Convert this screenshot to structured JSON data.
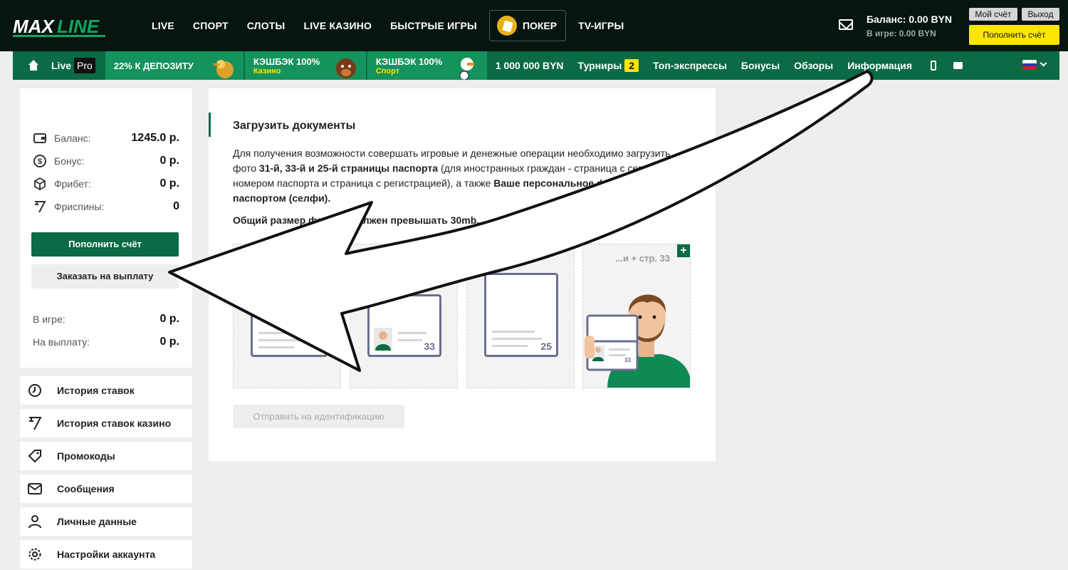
{
  "header": {
    "logo_text": "MAXLINE",
    "nav": [
      "LIVE",
      "СПОРТ",
      "СЛОТЫ",
      "LIVE КАЗИНО",
      "БЫСТРЫЕ ИГРЫ"
    ],
    "poker_label": "ПОКЕР",
    "tv_label": "TV-ИГРЫ",
    "balance_label": "Баланс: 0.00 BYN",
    "in_game_label": "В игре: 0.00 BYN",
    "my_account": "Мой счёт",
    "logout": "Выход",
    "topup": "Пополнить счёт"
  },
  "greenbar": {
    "live": "Live",
    "pro": "Pro",
    "promos": [
      {
        "title": "22% К ДЕПОЗИТУ",
        "sub": ""
      },
      {
        "title": "КЭШБЭК 100%",
        "sub": "Казино"
      },
      {
        "title": "КЭШБЭК 100%",
        "sub": "Спорт"
      }
    ],
    "items": [
      "1 000 000 BYN"
    ],
    "tournaments": "Турниры",
    "tournaments_count": "2",
    "items2": [
      "Топ-экспрессы",
      "Бонусы",
      "Обзоры",
      "Информация"
    ]
  },
  "balance_card": {
    "rows": [
      {
        "label": "Баланс:",
        "value": "1245.0 р."
      },
      {
        "label": "Бонус:",
        "value": "0 р."
      },
      {
        "label": "Фрибет:",
        "value": "0 р."
      },
      {
        "label": "Фриспины:",
        "value": "0"
      }
    ],
    "topup_button": "Пополнить счёт",
    "withdraw_button": "Заказать на выплату",
    "in_game_label": "В игре:",
    "in_game_value": "0 р.",
    "payout_label": "На выплату:",
    "payout_value": "0 р."
  },
  "menu": [
    {
      "label": "История ставок",
      "icon": "clock-icon"
    },
    {
      "label": "История ставок казино",
      "icon": "seven-icon"
    },
    {
      "label": "Промокоды",
      "icon": "tag-icon"
    },
    {
      "label": "Сообщения",
      "icon": "mail-icon"
    },
    {
      "label": "Личные данные",
      "icon": "user-icon"
    },
    {
      "label": "Настройки аккаунта",
      "icon": "gear-icon"
    }
  ],
  "content": {
    "title": "Загрузить документы",
    "text_1": "Для получения возможности совершать игровые и денежные операции необходимо загрузить фото ",
    "text_bold_1": "31-й, 33-й и 25-й страницы паспорта",
    "text_2": " (для иностранных граждан - страница с серией и номером паспорта и страница с регистрацией), а также ",
    "text_bold_2": "Ваше персональное фото с паспортом (селфи).",
    "size_note": "Общий размер фото не должен превышать 30mb.",
    "slots": [
      {
        "caption": "",
        "number": ""
      },
      {
        "caption": "",
        "number": "33"
      },
      {
        "caption": "",
        "number": "25"
      },
      {
        "caption": "...и + стр. 33",
        "number": "33"
      }
    ],
    "send_button": "Отправить на идентификацию"
  },
  "colors": {
    "brand_green": "#0a6b45",
    "accent_yellow": "#ffe600",
    "header_bg": "#07150f"
  }
}
